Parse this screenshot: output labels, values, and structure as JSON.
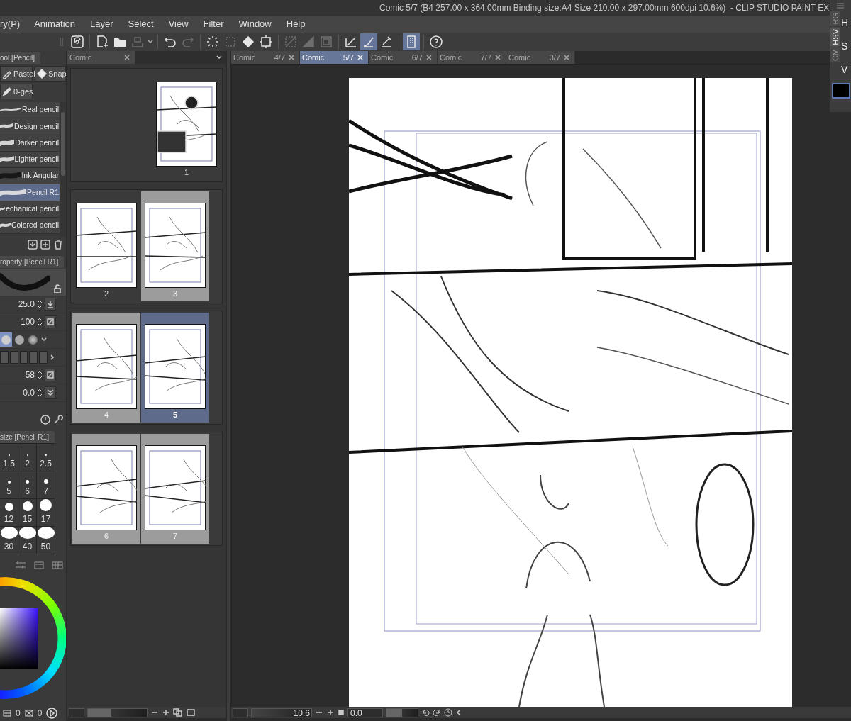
{
  "window": {
    "title": "Comic 5/7 (B4 257.00 x 364.00mm Binding size:A4 Size 210.00 x 297.00mm 600dpi 10.6%)  - CLIP STUDIO PAINT EX"
  },
  "menu": [
    "ry(P)",
    "Animation",
    "Layer",
    "Select",
    "View",
    "Filter",
    "Window",
    "Help"
  ],
  "toolbar": [
    {
      "disabled": false,
      "selected": false
    },
    {
      "disabled": false,
      "selected": false
    },
    {
      "disabled": false,
      "selected": false
    },
    {
      "disabled": true,
      "selected": false
    },
    {
      "disabled": false,
      "selected": false
    },
    {
      "disabled": true,
      "selected": false
    },
    {
      "disabled": false,
      "selected": false
    },
    {
      "disabled": true,
      "selected": false
    },
    {
      "disabled": false,
      "selected": false
    },
    {
      "disabled": false,
      "selected": false
    },
    {
      "disabled": true,
      "selected": false
    },
    {
      "disabled": true,
      "selected": false
    },
    {
      "disabled": true,
      "selected": false
    },
    {
      "disabled": false,
      "selected": false
    },
    {
      "disabled": false,
      "selected": true
    },
    {
      "disabled": false,
      "selected": false
    },
    {
      "disabled": false,
      "selected": true
    },
    {
      "disabled": false,
      "selected": false
    }
  ],
  "tool_panel": {
    "title": "ool [Pencil]",
    "groups": [
      "Pastel",
      "Snap",
      "0-ges"
    ]
  },
  "brushes": [
    {
      "name": "Real pencil",
      "selected": false
    },
    {
      "name": "Design pencil",
      "selected": false
    },
    {
      "name": "Darker pencil",
      "selected": false
    },
    {
      "name": "Lighter pencil",
      "selected": false
    },
    {
      "name": "Ink Angular",
      "selected": false
    },
    {
      "name": "Pencil R1",
      "selected": true
    },
    {
      "name": "echanical pencil",
      "selected": false
    },
    {
      "name": "Colored pencil",
      "selected": false
    }
  ],
  "tool_property": {
    "title": "roperty [Pencil R1]",
    "rows": [
      {
        "kind": "value",
        "value": "25.0"
      },
      {
        "kind": "value",
        "value": "100"
      },
      {
        "kind": "tips",
        "tips": [
          {
            "selected": true
          },
          {
            "selected": false
          },
          {
            "selected": false
          }
        ]
      },
      {
        "kind": "blank"
      },
      {
        "kind": "value",
        "value": "58"
      },
      {
        "kind": "value",
        "value": "0.0"
      }
    ]
  },
  "brush_size": {
    "title": "size [Pencil R1]",
    "sizes": [
      "1.5",
      "2",
      "2.5",
      "5",
      "6",
      "7",
      "12",
      "15",
      "17",
      "30",
      "40",
      "50"
    ]
  },
  "color_values": [
    "0",
    "0"
  ],
  "page_manager": {
    "tab": "Comic",
    "spreads": [
      {
        "pages": [
          {
            "label": "1",
            "highlighted": false,
            "selected": false
          }
        ]
      },
      {
        "pages": [
          {
            "label": "2",
            "highlighted": false,
            "selected": false
          },
          {
            "label": "3",
            "highlighted": true,
            "selected": false
          }
        ]
      },
      {
        "pages": [
          {
            "label": "4",
            "highlighted": true,
            "selected": false
          },
          {
            "label": "5",
            "highlighted": false,
            "selected": true
          }
        ]
      },
      {
        "pages": [
          {
            "label": "6",
            "highlighted": true,
            "selected": false
          },
          {
            "label": "7",
            "highlighted": true,
            "selected": false
          }
        ]
      }
    ]
  },
  "document_tabs": [
    {
      "title": "Comic",
      "page": "4/7",
      "selected": false
    },
    {
      "title": "Comic",
      "page": "5/7",
      "selected": true
    },
    {
      "title": "Comic",
      "page": "6/7",
      "selected": false
    },
    {
      "title": "Comic",
      "page": "7/7",
      "selected": false
    },
    {
      "title": "Comic",
      "page": "3/7",
      "selected": false
    }
  ],
  "status": {
    "page_zoom_slider": {
      "level": 0.4
    },
    "zoom": "10.6",
    "rotation": "0.0",
    "rotation_slider": {
      "level": 0.5
    }
  },
  "color_panel": {
    "tabs": [
      {
        "label": "RG",
        "selected": false
      },
      {
        "label": "HSV",
        "selected": true
      },
      {
        "label": "CM",
        "selected": false
      }
    ],
    "channels": [
      "H",
      "S",
      "V"
    ]
  }
}
